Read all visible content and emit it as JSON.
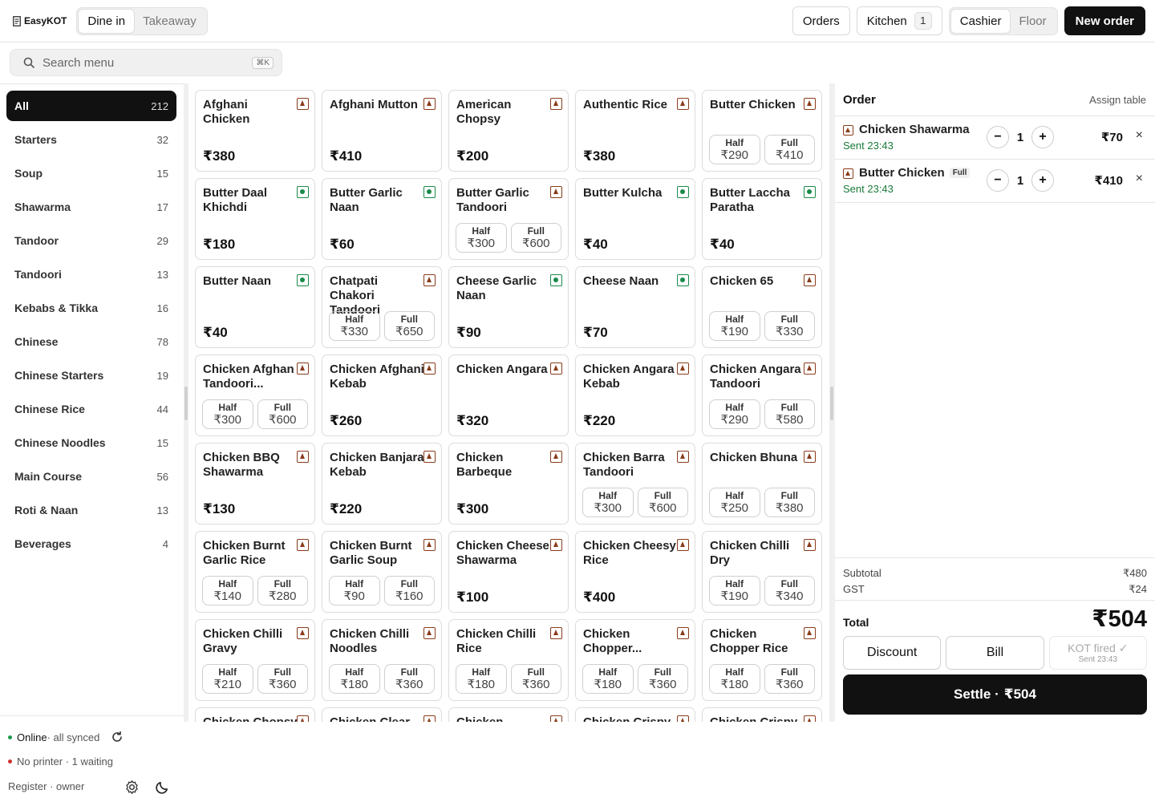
{
  "app": {
    "name": "EasyKOT"
  },
  "mode_tabs": [
    {
      "label": "Dine in",
      "active": true
    },
    {
      "label": "Takeaway",
      "active": false
    }
  ],
  "toolbar": {
    "orders_label": "Orders",
    "kitchen_label": "Kitchen",
    "kitchen_count": "1",
    "view_tabs": [
      {
        "label": "Cashier",
        "active": true
      },
      {
        "label": "Floor",
        "active": false
      }
    ],
    "new_order_label": "New order"
  },
  "search": {
    "placeholder": "Search menu",
    "shortcut": "⌘K"
  },
  "categories": [
    {
      "label": "All",
      "count": "212",
      "active": true
    },
    {
      "label": "Starters",
      "count": "32"
    },
    {
      "label": "Soup",
      "count": "15"
    },
    {
      "label": "Shawarma",
      "count": "17"
    },
    {
      "label": "Tandoor",
      "count": "29"
    },
    {
      "label": "Tandoori",
      "count": "13"
    },
    {
      "label": "Kebabs & Tikka",
      "count": "16"
    },
    {
      "label": "Chinese",
      "count": "78"
    },
    {
      "label": "Chinese Starters",
      "count": "19"
    },
    {
      "label": "Chinese Rice",
      "count": "44"
    },
    {
      "label": "Chinese Noodles",
      "count": "15"
    },
    {
      "label": "Main Course",
      "count": "56"
    },
    {
      "label": "Roti & Naan",
      "count": "13"
    },
    {
      "label": "Beverages",
      "count": "4"
    }
  ],
  "status": {
    "online_label": "Online",
    "online_detail": " · all synced",
    "online_color": "#1a9a4a",
    "printer_label": "No printer · 1 waiting",
    "printer_color": "#d03030",
    "register_label": "Register · owner"
  },
  "menu_items": [
    {
      "name": "Afghani Chicken",
      "veg": false,
      "price": "₹380"
    },
    {
      "name": "Afghani Mutton",
      "veg": false,
      "price": "₹410"
    },
    {
      "name": "American Chopsy",
      "veg": false,
      "price": "₹200"
    },
    {
      "name": "Authentic Rice",
      "veg": false,
      "price": "₹380"
    },
    {
      "name": "Butter Chicken",
      "veg": false,
      "half": "₹290",
      "full": "₹410"
    },
    {
      "name": "Butter Daal Khichdi",
      "veg": true,
      "price": "₹180"
    },
    {
      "name": "Butter Garlic Naan",
      "veg": true,
      "price": "₹60"
    },
    {
      "name": "Butter Garlic Tandoori",
      "veg": false,
      "half": "₹300",
      "full": "₹600"
    },
    {
      "name": "Butter Kulcha",
      "veg": true,
      "price": "₹40"
    },
    {
      "name": "Butter Laccha Paratha",
      "veg": true,
      "price": "₹40"
    },
    {
      "name": "Butter Naan",
      "veg": true,
      "price": "₹40"
    },
    {
      "name": "Chatpati Chakori Tandoori",
      "veg": false,
      "half": "₹330",
      "full": "₹650"
    },
    {
      "name": "Cheese Garlic Naan",
      "veg": true,
      "price": "₹90"
    },
    {
      "name": "Cheese Naan",
      "veg": true,
      "price": "₹70"
    },
    {
      "name": "Chicken 65",
      "veg": false,
      "half": "₹190",
      "full": "₹330"
    },
    {
      "name": "Chicken Afghan Tandoori...",
      "veg": false,
      "half": "₹300",
      "full": "₹600"
    },
    {
      "name": "Chicken Afghani Kebab",
      "veg": false,
      "price": "₹260"
    },
    {
      "name": "Chicken Angara",
      "veg": false,
      "price": "₹320"
    },
    {
      "name": "Chicken Angara Kebab",
      "veg": false,
      "price": "₹220"
    },
    {
      "name": "Chicken Angara Tandoori",
      "veg": false,
      "half": "₹290",
      "full": "₹580"
    },
    {
      "name": "Chicken BBQ Shawarma",
      "veg": false,
      "price": "₹130"
    },
    {
      "name": "Chicken Banjara Kebab",
      "veg": false,
      "price": "₹220"
    },
    {
      "name": "Chicken Barbeque",
      "veg": false,
      "price": "₹300"
    },
    {
      "name": "Chicken Barra Tandoori",
      "veg": false,
      "half": "₹300",
      "full": "₹600"
    },
    {
      "name": "Chicken Bhuna",
      "veg": false,
      "half": "₹250",
      "full": "₹380"
    },
    {
      "name": "Chicken Burnt Garlic Rice",
      "veg": false,
      "half": "₹140",
      "full": "₹280"
    },
    {
      "name": "Chicken Burnt Garlic Soup",
      "veg": false,
      "half": "₹90",
      "full": "₹160"
    },
    {
      "name": "Chicken Cheese Shawarma",
      "veg": false,
      "price": "₹100"
    },
    {
      "name": "Chicken Cheesy Rice",
      "veg": false,
      "price": "₹400"
    },
    {
      "name": "Chicken Chilli Dry",
      "veg": false,
      "half": "₹190",
      "full": "₹340"
    },
    {
      "name": "Chicken Chilli Gravy",
      "veg": false,
      "half": "₹210",
      "full": "₹360"
    },
    {
      "name": "Chicken Chilli Noodles",
      "veg": false,
      "half": "₹180",
      "full": "₹360"
    },
    {
      "name": "Chicken Chilli Rice",
      "veg": false,
      "half": "₹180",
      "full": "₹360"
    },
    {
      "name": "Chicken Chopper...",
      "veg": false,
      "half": "₹180",
      "full": "₹360"
    },
    {
      "name": "Chicken Chopper Rice",
      "veg": false,
      "half": "₹180",
      "full": "₹360"
    },
    {
      "name": "Chicken Chopsy",
      "veg": false,
      "price": ""
    },
    {
      "name": "Chicken Clear",
      "veg": false,
      "price": ""
    },
    {
      "name": "Chicken",
      "veg": false,
      "price": ""
    },
    {
      "name": "Chicken Crispy",
      "veg": false,
      "price": ""
    },
    {
      "name": "Chicken Crispy",
      "veg": false,
      "price": ""
    }
  ],
  "variant_labels": {
    "half": "Half",
    "full": "Full"
  },
  "order": {
    "title": "Order",
    "assign_table_label": "Assign table",
    "lines": [
      {
        "name": "Chicken Shawarma",
        "variant": "",
        "sent": "Sent 23:43",
        "qty": "1",
        "amount": "₹70"
      },
      {
        "name": "Butter Chicken",
        "variant": "Full",
        "sent": "Sent 23:43",
        "qty": "1",
        "amount": "₹410"
      }
    ],
    "subtotal_label": "Subtotal",
    "subtotal": "₹480",
    "gst_label": "GST",
    "gst": "₹24",
    "total_label": "Total",
    "total": "₹504",
    "discount_label": "Discount",
    "bill_label": "Bill",
    "kot_label": "KOT fired ✓",
    "kot_time": "Sent 23:43",
    "settle_label": "Settle ·",
    "settle_amount": "₹504"
  }
}
